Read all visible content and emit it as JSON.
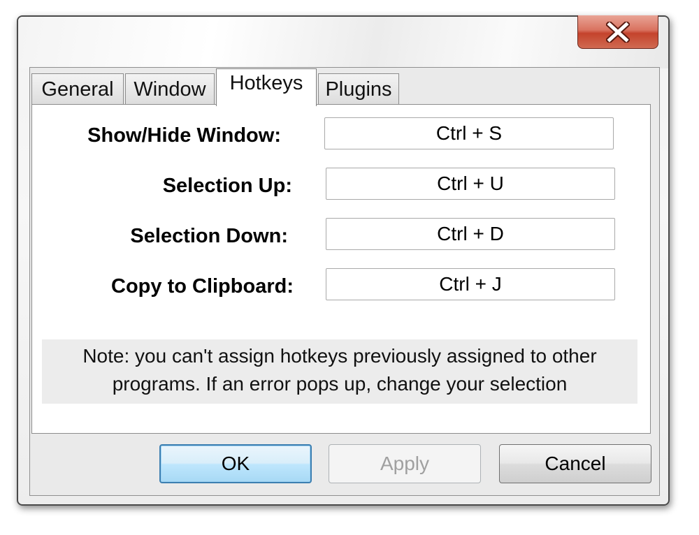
{
  "window": {
    "close_label": "Close"
  },
  "tabs": [
    {
      "label": "General",
      "active": false
    },
    {
      "label": "Window",
      "active": false
    },
    {
      "label": "Hotkeys",
      "active": true
    },
    {
      "label": "Plugins",
      "active": false
    }
  ],
  "hotkeys": [
    {
      "label": "Show/Hide Window:",
      "value": "Ctrl + S"
    },
    {
      "label": "Selection Up:",
      "value": "Ctrl + U"
    },
    {
      "label": "Selection Down:",
      "value": "Ctrl + D"
    },
    {
      "label": "Copy to Clipboard:",
      "value": "Ctrl + J"
    }
  ],
  "note": {
    "line1": "Note: you can't assign hotkeys previously assigned to other",
    "line2": "programs. If an error pops up, change your selection"
  },
  "buttons": {
    "ok": "OK",
    "apply": "Apply",
    "cancel": "Cancel"
  },
  "colors": {
    "close_button": "#c4432c",
    "default_button_border": "#3c7fb1",
    "disabled_text": "#a0a0a0"
  }
}
